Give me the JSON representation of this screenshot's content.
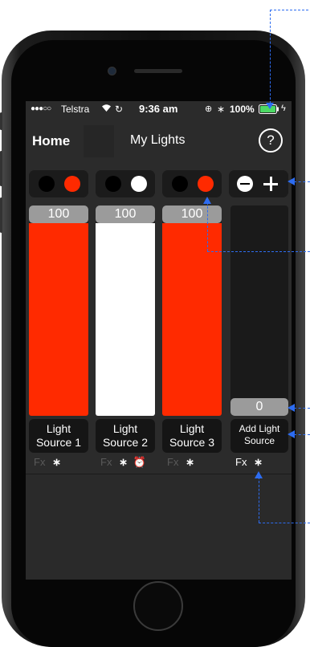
{
  "status_bar": {
    "signal": "●●●○○",
    "carrier": "Telstra",
    "time": "9:36 am",
    "battery": "100%"
  },
  "nav": {
    "home_label": "Home",
    "title": "My Lights",
    "help_label": "?"
  },
  "columns": [
    {
      "value": "100",
      "level": 1.0,
      "color": "#ff2a00",
      "name_line1": "Light",
      "name_line2": "Source 1",
      "fx_label": "Fx",
      "has_alarm": false
    },
    {
      "value": "100",
      "level": 1.0,
      "color": "#ffffff",
      "name_line1": "Light",
      "name_line2": "Source 2",
      "fx_label": "Fx",
      "has_alarm": true
    },
    {
      "value": "100",
      "level": 1.0,
      "color": "#ff2a00",
      "name_line1": "Light",
      "name_line2": "Source 3",
      "fx_label": "Fx",
      "has_alarm": false
    }
  ],
  "add_column": {
    "value": "0",
    "level": 0.0,
    "name_line1": "Add Light",
    "name_line2": "Source",
    "fx_label": "Fx"
  },
  "colors": {
    "accent_red": "#ff2a00",
    "annotation_blue": "#2d6cf0",
    "screen_bg": "#2b2b2b"
  },
  "icons": [
    "wifi-icon",
    "sync-icon",
    "rotation-lock-icon",
    "bluetooth-icon",
    "battery-icon",
    "charging-icon",
    "help-icon",
    "minus-icon",
    "plus-icon",
    "alarm-clock-icon"
  ]
}
